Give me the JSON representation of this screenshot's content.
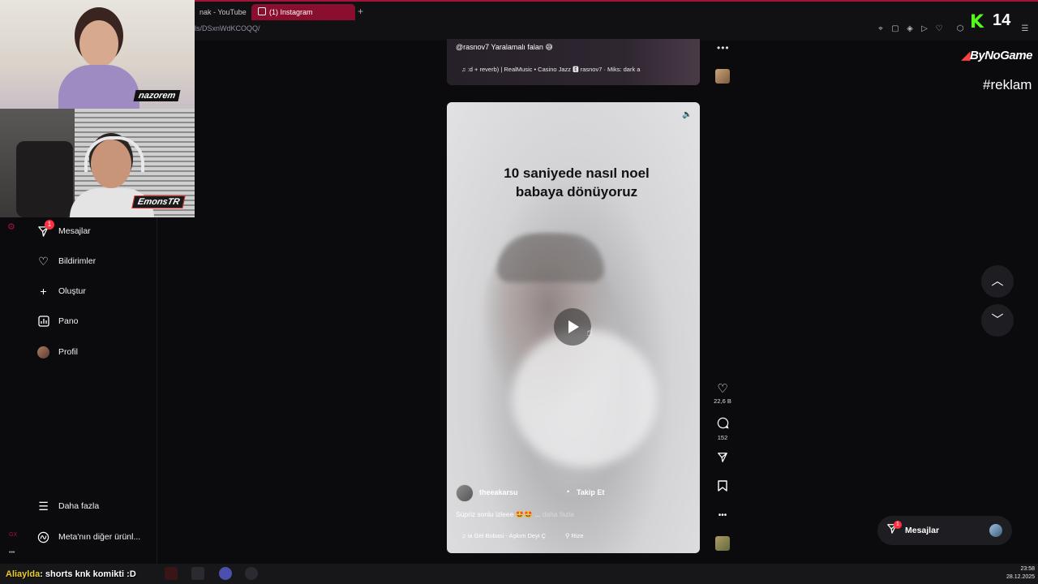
{
  "browser": {
    "tabs": [
      {
        "label": "nak - YouTube"
      },
      {
        "label": "(1) Instagram"
      }
    ],
    "url": "ls/DSxnWdKCOQQ/"
  },
  "webcams": {
    "cam1_name": "nazorem",
    "cam2_name": "EmonsTR"
  },
  "overlay": {
    "kick_letter": "K",
    "kick_count": "14",
    "sponsor": "ByNoGame",
    "hashtag": "#reklam"
  },
  "sidebar": {
    "items": [
      {
        "label": "Mesajlar",
        "icon": "send-icon",
        "badge": "1"
      },
      {
        "label": "Bildirimler",
        "icon": "heart-icon"
      },
      {
        "label": "Oluştur",
        "icon": "plus-icon"
      },
      {
        "label": "Pano",
        "icon": "chart-icon"
      },
      {
        "label": "Profil",
        "icon": "avatar"
      }
    ],
    "bottom_items": [
      {
        "label": "Daha fazla",
        "icon": "hamburger-icon"
      },
      {
        "label": "Meta'nın diğer ürünl...",
        "icon": "meta-icon"
      }
    ]
  },
  "previous_reel": {
    "caption": "@rasnov7 Yaralamalı falan 😅",
    "music": "♫ :d + reverb) | RealMusic • Casino Jazz 🅴  rasnov7 · Miks: dark a"
  },
  "reel": {
    "title_line1": "10 saniyede nasıl noel",
    "title_line2": "babaya dönüyoruz",
    "author": "theeakarsu",
    "separator": "•",
    "follow": "Takip Et",
    "caption": "Süpriz sonlu izleee 🤩🤩 ...",
    "more": "daha fazla",
    "music": "♫ ia Gel  Bobasi - Aşkım Deyi Ç",
    "location": "Rize"
  },
  "actions": {
    "likes": "22,6 B",
    "comments": "152"
  },
  "messages_pill": {
    "label": "Mesajlar",
    "badge": "1"
  },
  "chat": {
    "user": "Aliaylda",
    "message": ": shorts knk komikti :D"
  },
  "clock": {
    "time": "23:58",
    "date": "28.12.2025"
  },
  "colors": {
    "accent": "#a3133a",
    "instagram_tab": "#8a0f2e",
    "kick_green": "#53fc18",
    "badge_red": "#ff3040"
  }
}
